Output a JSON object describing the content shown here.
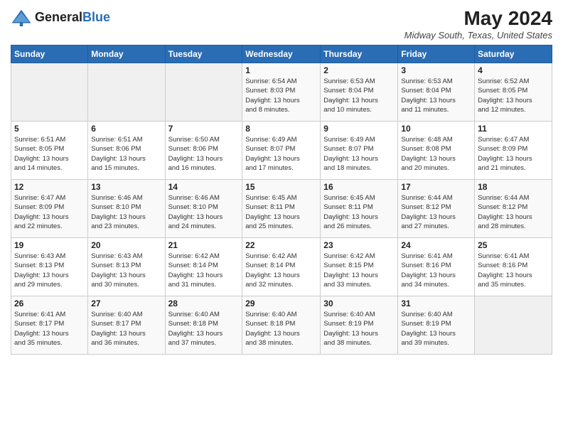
{
  "header": {
    "logo_general": "General",
    "logo_blue": "Blue",
    "month_year": "May 2024",
    "location": "Midway South, Texas, United States"
  },
  "days_of_week": [
    "Sunday",
    "Monday",
    "Tuesday",
    "Wednesday",
    "Thursday",
    "Friday",
    "Saturday"
  ],
  "weeks": [
    [
      {
        "day": "",
        "info": ""
      },
      {
        "day": "",
        "info": ""
      },
      {
        "day": "",
        "info": ""
      },
      {
        "day": "1",
        "info": "Sunrise: 6:54 AM\nSunset: 8:03 PM\nDaylight: 13 hours\nand 8 minutes."
      },
      {
        "day": "2",
        "info": "Sunrise: 6:53 AM\nSunset: 8:04 PM\nDaylight: 13 hours\nand 10 minutes."
      },
      {
        "day": "3",
        "info": "Sunrise: 6:53 AM\nSunset: 8:04 PM\nDaylight: 13 hours\nand 11 minutes."
      },
      {
        "day": "4",
        "info": "Sunrise: 6:52 AM\nSunset: 8:05 PM\nDaylight: 13 hours\nand 12 minutes."
      }
    ],
    [
      {
        "day": "5",
        "info": "Sunrise: 6:51 AM\nSunset: 8:05 PM\nDaylight: 13 hours\nand 14 minutes."
      },
      {
        "day": "6",
        "info": "Sunrise: 6:51 AM\nSunset: 8:06 PM\nDaylight: 13 hours\nand 15 minutes."
      },
      {
        "day": "7",
        "info": "Sunrise: 6:50 AM\nSunset: 8:06 PM\nDaylight: 13 hours\nand 16 minutes."
      },
      {
        "day": "8",
        "info": "Sunrise: 6:49 AM\nSunset: 8:07 PM\nDaylight: 13 hours\nand 17 minutes."
      },
      {
        "day": "9",
        "info": "Sunrise: 6:49 AM\nSunset: 8:07 PM\nDaylight: 13 hours\nand 18 minutes."
      },
      {
        "day": "10",
        "info": "Sunrise: 6:48 AM\nSunset: 8:08 PM\nDaylight: 13 hours\nand 20 minutes."
      },
      {
        "day": "11",
        "info": "Sunrise: 6:47 AM\nSunset: 8:09 PM\nDaylight: 13 hours\nand 21 minutes."
      }
    ],
    [
      {
        "day": "12",
        "info": "Sunrise: 6:47 AM\nSunset: 8:09 PM\nDaylight: 13 hours\nand 22 minutes."
      },
      {
        "day": "13",
        "info": "Sunrise: 6:46 AM\nSunset: 8:10 PM\nDaylight: 13 hours\nand 23 minutes."
      },
      {
        "day": "14",
        "info": "Sunrise: 6:46 AM\nSunset: 8:10 PM\nDaylight: 13 hours\nand 24 minutes."
      },
      {
        "day": "15",
        "info": "Sunrise: 6:45 AM\nSunset: 8:11 PM\nDaylight: 13 hours\nand 25 minutes."
      },
      {
        "day": "16",
        "info": "Sunrise: 6:45 AM\nSunset: 8:11 PM\nDaylight: 13 hours\nand 26 minutes."
      },
      {
        "day": "17",
        "info": "Sunrise: 6:44 AM\nSunset: 8:12 PM\nDaylight: 13 hours\nand 27 minutes."
      },
      {
        "day": "18",
        "info": "Sunrise: 6:44 AM\nSunset: 8:12 PM\nDaylight: 13 hours\nand 28 minutes."
      }
    ],
    [
      {
        "day": "19",
        "info": "Sunrise: 6:43 AM\nSunset: 8:13 PM\nDaylight: 13 hours\nand 29 minutes."
      },
      {
        "day": "20",
        "info": "Sunrise: 6:43 AM\nSunset: 8:13 PM\nDaylight: 13 hours\nand 30 minutes."
      },
      {
        "day": "21",
        "info": "Sunrise: 6:42 AM\nSunset: 8:14 PM\nDaylight: 13 hours\nand 31 minutes."
      },
      {
        "day": "22",
        "info": "Sunrise: 6:42 AM\nSunset: 8:14 PM\nDaylight: 13 hours\nand 32 minutes."
      },
      {
        "day": "23",
        "info": "Sunrise: 6:42 AM\nSunset: 8:15 PM\nDaylight: 13 hours\nand 33 minutes."
      },
      {
        "day": "24",
        "info": "Sunrise: 6:41 AM\nSunset: 8:16 PM\nDaylight: 13 hours\nand 34 minutes."
      },
      {
        "day": "25",
        "info": "Sunrise: 6:41 AM\nSunset: 8:16 PM\nDaylight: 13 hours\nand 35 minutes."
      }
    ],
    [
      {
        "day": "26",
        "info": "Sunrise: 6:41 AM\nSunset: 8:17 PM\nDaylight: 13 hours\nand 35 minutes."
      },
      {
        "day": "27",
        "info": "Sunrise: 6:40 AM\nSunset: 8:17 PM\nDaylight: 13 hours\nand 36 minutes."
      },
      {
        "day": "28",
        "info": "Sunrise: 6:40 AM\nSunset: 8:18 PM\nDaylight: 13 hours\nand 37 minutes."
      },
      {
        "day": "29",
        "info": "Sunrise: 6:40 AM\nSunset: 8:18 PM\nDaylight: 13 hours\nand 38 minutes."
      },
      {
        "day": "30",
        "info": "Sunrise: 6:40 AM\nSunset: 8:19 PM\nDaylight: 13 hours\nand 38 minutes."
      },
      {
        "day": "31",
        "info": "Sunrise: 6:40 AM\nSunset: 8:19 PM\nDaylight: 13 hours\nand 39 minutes."
      },
      {
        "day": "",
        "info": ""
      }
    ]
  ]
}
